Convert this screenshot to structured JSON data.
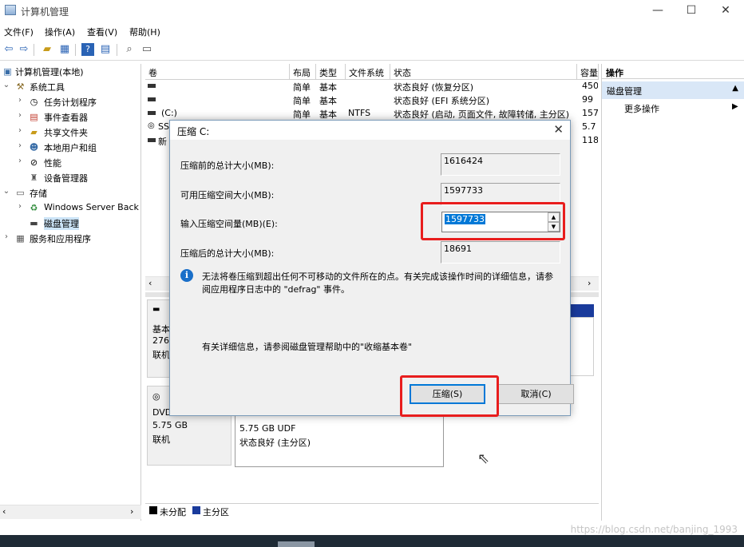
{
  "window": {
    "title": "计算机管理",
    "controls": {
      "minimize": "—",
      "maximize": "☐",
      "close": "✕"
    }
  },
  "menu": [
    "文件(F)",
    "操作(A)",
    "查看(V)",
    "帮助(H)"
  ],
  "tree": {
    "root": "计算机管理(本地)",
    "items": [
      {
        "label": "系统工具",
        "level": 1,
        "expanded": true
      },
      {
        "label": "任务计划程序",
        "level": 2
      },
      {
        "label": "事件查看器",
        "level": 2
      },
      {
        "label": "共享文件夹",
        "level": 2
      },
      {
        "label": "本地用户和组",
        "level": 2
      },
      {
        "label": "性能",
        "level": 2
      },
      {
        "label": "设备管理器",
        "level": 2
      },
      {
        "label": "存储",
        "level": 1,
        "expanded": true
      },
      {
        "label": "Windows Server Back",
        "level": 2
      },
      {
        "label": "磁盘管理",
        "level": 2,
        "selected": true
      },
      {
        "label": "服务和应用程序",
        "level": 1
      }
    ]
  },
  "volumes": {
    "columns": [
      "卷",
      "布局",
      "类型",
      "文件系统",
      "状态",
      "容量"
    ],
    "rows": [
      {
        "name": "",
        "layout": "简单",
        "type": "基本",
        "fs": "",
        "status": "状态良好 (恢复分区)",
        "capacity": "450"
      },
      {
        "name": "",
        "layout": "简单",
        "type": "基本",
        "fs": "",
        "status": "状态良好 (EFI 系统分区)",
        "capacity": "99"
      },
      {
        "name": "(C:)",
        "layout": "简单",
        "type": "基本",
        "fs": "NTFS",
        "status": "状态良好 (启动, 页面文件, 故障转储, 主分区)",
        "capacity": "157"
      },
      {
        "name": "SS",
        "layout": "",
        "type": "",
        "fs": "",
        "status": "",
        "capacity": "5.7"
      },
      {
        "name": "新",
        "layout": "",
        "type": "",
        "fs": "",
        "status": "",
        "capacity": "118"
      }
    ]
  },
  "disks": {
    "disk0": {
      "line1": "基本",
      "line2": "2764",
      "line3": "联机"
    },
    "dvd": {
      "name": "DVD",
      "size": "5.75 GB",
      "state": "联机",
      "partition_size": "5.75 GB UDF",
      "partition_status": "状态良好 (主分区)"
    }
  },
  "legend": [
    {
      "label": "未分配",
      "color": "#000000"
    },
    {
      "label": "主分区",
      "color": "#1a3b9c"
    }
  ],
  "actions": {
    "header": "操作",
    "section": "磁盘管理",
    "item": "更多操作"
  },
  "dialog": {
    "title": "压缩 C:",
    "fields": [
      {
        "label": "压缩前的总计大小(MB):",
        "value": "1616424"
      },
      {
        "label": "可用压缩空间大小(MB):",
        "value": "1597733"
      },
      {
        "label": "输入压缩空间量(MB)(E):",
        "value": "1597733"
      },
      {
        "label": "压缩后的总计大小(MB):",
        "value": "18691"
      }
    ],
    "info": "无法将卷压缩到超出任何不可移动的文件所在的点。有关完成该操作时间的详细信息，请参阅应用程序日志中的 \"defrag\" 事件。",
    "help": "有关详细信息，请参阅磁盘管理帮助中的\"收缩基本卷\"",
    "shrink_button": "压缩(S)",
    "cancel_button": "取消(C)"
  },
  "watermark": "https://blog.csdn.net/banjing_1993",
  "colors": {
    "accent": "#0078d7",
    "highlight": "#e81d1d"
  }
}
